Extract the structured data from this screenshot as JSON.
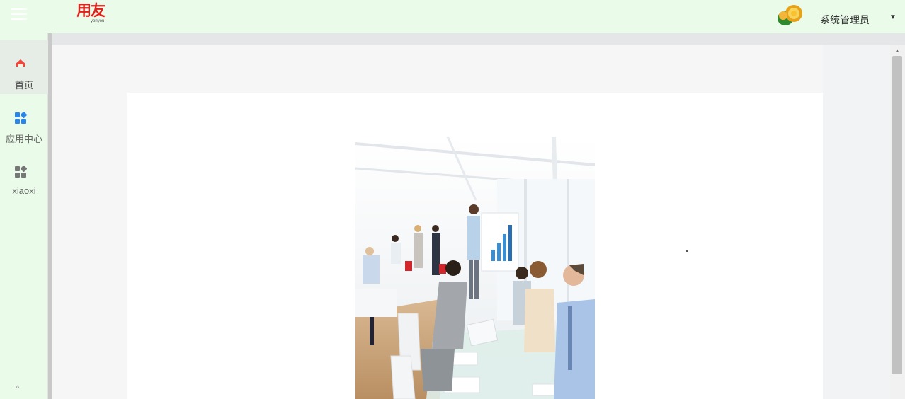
{
  "header": {
    "logo_text": "用友",
    "logo_sub": "yonyou",
    "username": "系统管理员",
    "menu_icon": "hamburger-icon",
    "caret_icon": "caret-down-icon"
  },
  "sidebar": {
    "items": [
      {
        "label": "首页",
        "icon": "home-icon",
        "color": "#f0463b",
        "active": true
      },
      {
        "label": "应用中心",
        "icon": "apps-icon",
        "color": "#2b86e8",
        "active": false
      },
      {
        "label": "xiaoxi",
        "icon": "grid-icon",
        "color": "#777777",
        "active": false
      }
    ],
    "collapse_glyph": "^"
  },
  "colors": {
    "header_bg": "#eafbe9",
    "brand_red": "#e0201b"
  }
}
